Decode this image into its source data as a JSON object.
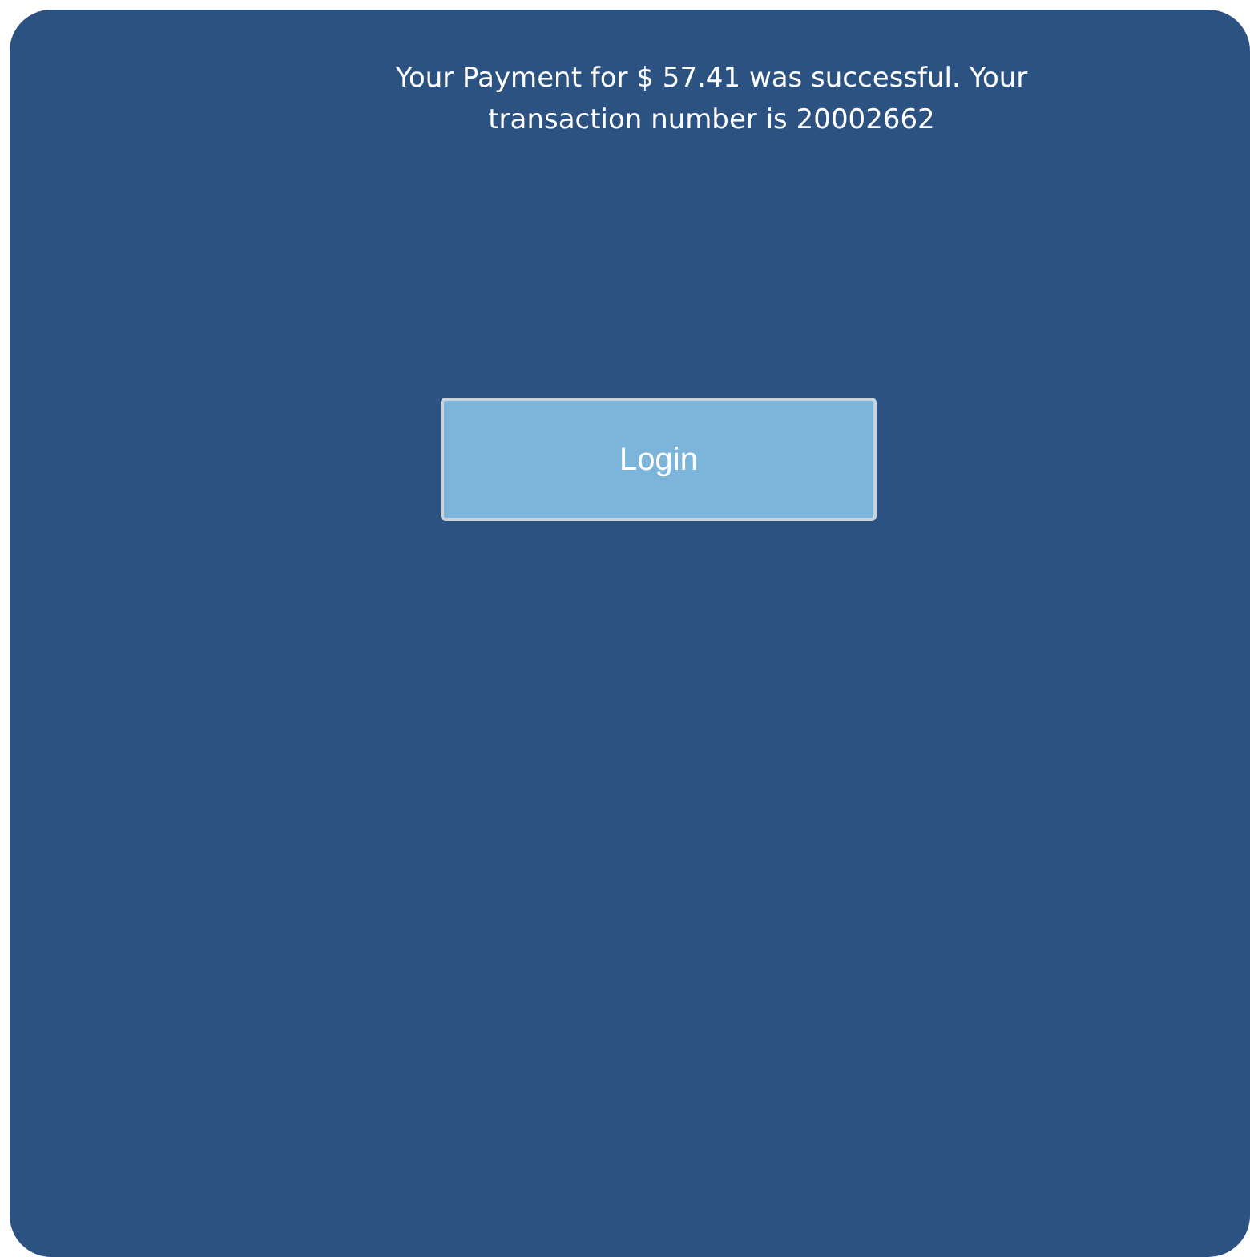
{
  "message": "Your Payment for $ 57.41 was successful. Your transaction number is 20002662",
  "buttons": [
    {
      "label": "Login"
    }
  ]
}
